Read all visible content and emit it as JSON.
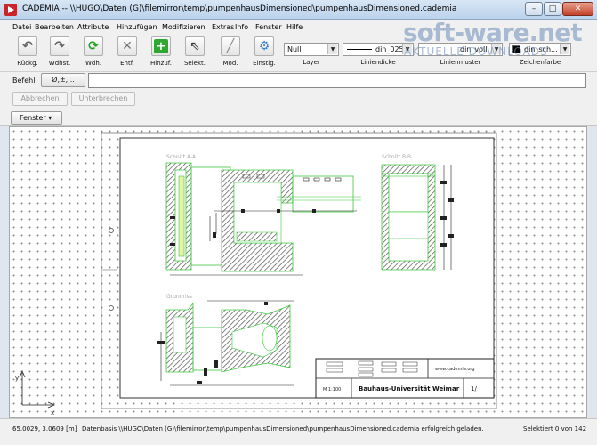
{
  "window": {
    "title": "CADEMIA -- \\\\HUGO\\Daten (G)\\filemirror\\temp\\pumpenhausDimensioned\\pumpenhausDimensioned.cademia",
    "min_glyph": "–",
    "max_glyph": "□",
    "close_glyph": "✕"
  },
  "menu": [
    "Datei",
    "Bearbeiten",
    "Attribute",
    "Hinzufügen",
    "Modifizieren",
    "Extras",
    "Info",
    "Fenster",
    "Hilfe"
  ],
  "toolbar": {
    "tools": [
      {
        "name": "undo",
        "label": "Rückg.",
        "glyph": "↶"
      },
      {
        "name": "redo",
        "label": "Wdhst.",
        "glyph": "↷"
      },
      {
        "name": "repeat",
        "label": "Wdh.",
        "glyph": "⟳"
      },
      {
        "name": "delete",
        "label": "Entf.",
        "glyph": "✕"
      },
      {
        "name": "add",
        "label": "Hinzuf.",
        "glyph": "+"
      },
      {
        "name": "select",
        "label": "Selekt.",
        "glyph": "⇖"
      },
      {
        "name": "modify",
        "label": "Mod.",
        "glyph": "╱"
      },
      {
        "name": "settings",
        "label": "Einstig.",
        "glyph": "⚙"
      }
    ],
    "layer": {
      "value": "Null",
      "label": "Layer"
    },
    "line_width": {
      "value": "din_025",
      "label": "Liniendicke"
    },
    "line_pattern": {
      "value": "din_voll",
      "label": "Linienmuster"
    },
    "color": {
      "value": "din_sch...",
      "label": "Zeichenfarbe",
      "swatch": "#000000"
    }
  },
  "watermark": {
    "main": "soft-ware.net",
    "sub": "AKTUELLE DOWNLOADS"
  },
  "command": {
    "label": "Befehl",
    "button": "Ø,±,...",
    "value": ""
  },
  "actions": {
    "cancel": "Abbrechen",
    "interrupt": "Unterbrechen"
  },
  "windows_button": "Fenster ▾",
  "drawing": {
    "section_aa": "Schnitt A-A",
    "section_bb": "Schnitt B-B",
    "floorplan": "Grundriss",
    "org": "Bauhaus-Universität Weimar",
    "url": "www.cademia.org",
    "scale": "M 1:100",
    "sheet": "1/",
    "hatch_color": "#555555",
    "line_color": "#3cc93c",
    "dim_color": "#222222"
  },
  "status": {
    "coords": "65.0029, 3.0609 [m]",
    "message": "Datenbasis \\\\HUGO\\Daten (G)\\filemirror\\temp\\pumpenhausDimensioned\\pumpenhausDimensioned.cademia erfolgreich geladen.",
    "selection": "Selektiert 0 von 142"
  },
  "axis": {
    "x": "x",
    "y": "y"
  }
}
